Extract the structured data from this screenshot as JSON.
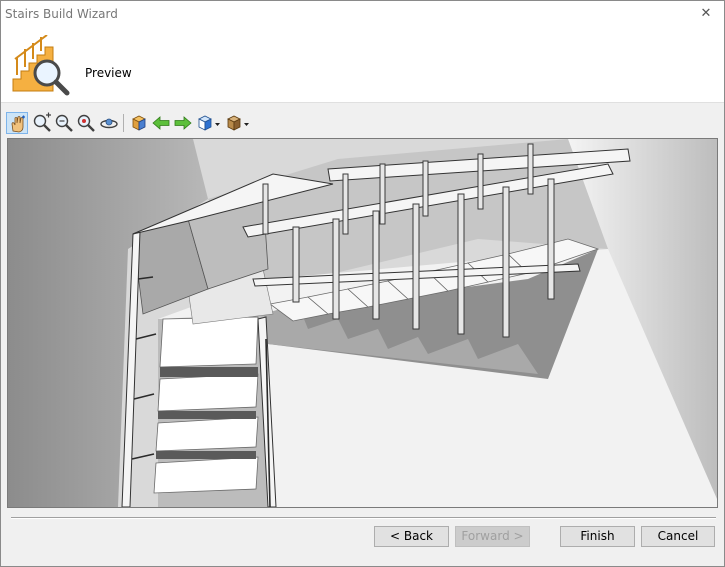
{
  "window": {
    "title": "Stairs Build Wizard",
    "close_glyph": "✕"
  },
  "header": {
    "step_title": "Preview",
    "logo_icon": "stairs-preview-icon"
  },
  "toolbar": {
    "tools": [
      {
        "icon": "pan-hand-icon",
        "active": true
      },
      {
        "icon": "zoom-in-icon"
      },
      {
        "icon": "zoom-out-icon"
      },
      {
        "icon": "zoom-extents-icon"
      },
      {
        "icon": "orbit-icon"
      },
      {
        "icon": "view-cube-icon"
      },
      {
        "icon": "previous-view-icon"
      },
      {
        "icon": "next-view-icon"
      },
      {
        "icon": "view-direction-dropdown-icon"
      },
      {
        "icon": "render-mode-dropdown-icon"
      }
    ]
  },
  "buttons": {
    "back": "< Back",
    "forward": "Forward >",
    "finish": "Finish",
    "cancel": "Cancel"
  },
  "colors": {
    "accent": "#cce4f7",
    "logo": "#f5a623"
  }
}
